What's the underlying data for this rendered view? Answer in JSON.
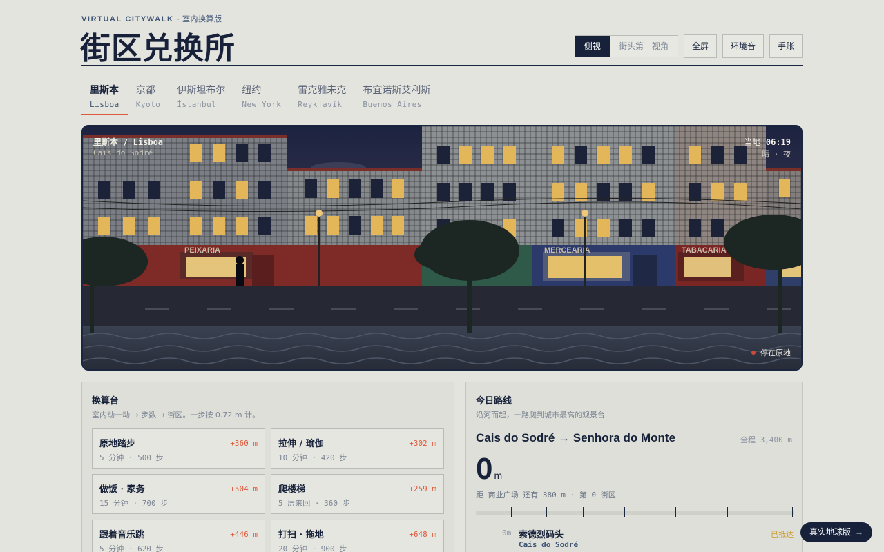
{
  "header": {
    "eyebrow": "VIRTUAL CITYWALK",
    "eyebrow_sub": "· 室内换算版",
    "title": "街区兑换所"
  },
  "toolbar": {
    "view_options": [
      "侧视",
      "街头第一视角"
    ],
    "active_view": "侧视",
    "fullscreen": "全屏",
    "ambient": "环境音",
    "journal": "手账"
  },
  "cities": [
    {
      "zh": "里斯本",
      "en": "Lisboa",
      "active": true
    },
    {
      "zh": "京都",
      "en": "Kyoto",
      "active": false
    },
    {
      "zh": "伊斯坦布尔",
      "en": "İstanbul",
      "active": false
    },
    {
      "zh": "纽约",
      "en": "New York",
      "active": false
    },
    {
      "zh": "雷克雅未克",
      "en": "Reykjavík",
      "active": false
    },
    {
      "zh": "布宜诺斯艾利斯",
      "en": "Buenos Aires",
      "active": false
    }
  ],
  "scene": {
    "city": "里斯本 / Lisboa",
    "spot": "Cais do Sodré",
    "time_label": "当地",
    "time": "06:19",
    "weather": "晴 · 夜",
    "status": "停在原地",
    "shop_signs": [
      "PEIXARIA",
      "MERCEARIA",
      "TABACARIA"
    ]
  },
  "converter": {
    "title": "换算台",
    "subtitle": "室内动一动 → 步数 → 街区。一步按 0.72 m 计。",
    "activities": [
      {
        "name": "原地踏步",
        "gain": "+360 m",
        "meta": "5 分钟 · 500 步"
      },
      {
        "name": "拉伸 / 瑜伽",
        "gain": "+302 m",
        "meta": "10 分钟 · 420 步"
      },
      {
        "name": "做饭 · 家务",
        "gain": "+504 m",
        "meta": "15 分钟 · 700 步"
      },
      {
        "name": "爬楼梯",
        "gain": "+259 m",
        "meta": "5 层来回 · 360 步"
      },
      {
        "name": "跟着音乐跳",
        "gain": "+446 m",
        "meta": "5 分钟 · 620 步"
      },
      {
        "name": "打扫 · 拖地",
        "gain": "+648 m",
        "meta": "20 分钟 · 900 步"
      }
    ]
  },
  "route": {
    "title": "今日路线",
    "subtitle": "沿河而起，一路爬到城市最高的观景台",
    "name": "Cais do Sodré → Senhora do Monte",
    "total": "全程 3,400 m",
    "distance_value": "0",
    "distance_unit": "m",
    "progress_text": "距 商业广场 还有 380 m · 第 0 街区",
    "progress_fraction": 0,
    "stop": {
      "dist": "0m",
      "zh": "索德烈码头",
      "en": "Cais do Sodré",
      "status": "已抵达"
    }
  },
  "fab": {
    "label": "真实地球版",
    "arrow": "→"
  },
  "colors": {
    "accent": "#e05a3a",
    "navy": "#17223a",
    "arrived": "#c99a2a"
  }
}
